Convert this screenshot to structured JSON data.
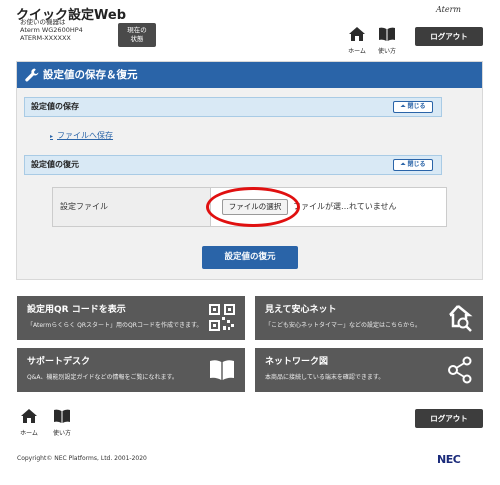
{
  "header": {
    "app_title": "クイック設定Web",
    "device_line1": "お使いの機器は",
    "device_line2": "Aterm WG2600HP4",
    "device_line3": "ATERM-XXXXXX",
    "status_line1": "現在の",
    "status_line2": "状態",
    "logo": "Aterm",
    "home_label": "ホーム",
    "help_label": "使い方",
    "logout_label": "ログアウト"
  },
  "panel": {
    "title": "設定値の保存＆復元",
    "save_section": "設定値の保存",
    "restore_section": "設定値の復元",
    "collapse_label": "閉じる",
    "save_link": "ファイルへ保存",
    "file_label": "設定ファイル",
    "file_button": "ファイルの選択",
    "file_status": "ファイルが選…れていません",
    "restore_button": "設定値の復元"
  },
  "tiles": [
    {
      "title": "設定用QR コードを表示",
      "desc": "「Atermらくらく QRスタート」用のQRコードを作成できます。"
    },
    {
      "title": "見えて安心ネット",
      "desc": "「こども安心ネットタイマー」などの設定はこちらから。"
    },
    {
      "title": "サポートデスク",
      "desc": "Q&A、機能別設定ガイドなどの情報をご覧になれます。"
    },
    {
      "title": "ネットワーク図",
      "desc": "本商品に接続している端末を確認できます。"
    }
  ],
  "footer": {
    "home_label": "ホーム",
    "help_label": "使い方",
    "logout_label": "ログアウト",
    "copyright": "Copyright© NEC Platforms, Ltd. 2001-2020",
    "brand": "NEC"
  },
  "colors": {
    "accent": "#2a64a8",
    "section_bg": "#d9e9f5",
    "tile_bg": "#595959",
    "highlight": "#e01010"
  }
}
